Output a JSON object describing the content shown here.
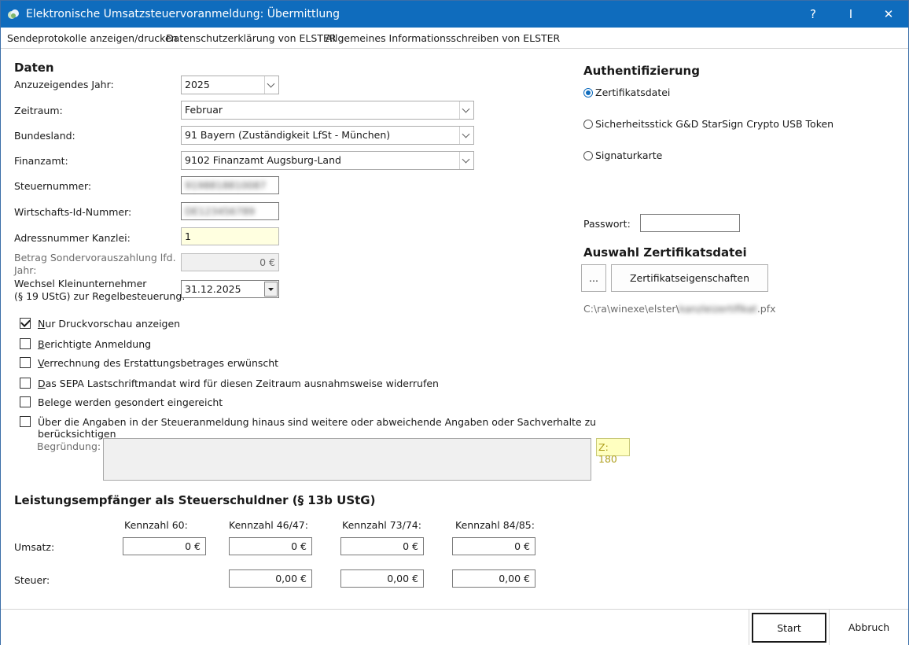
{
  "window": {
    "title": "Elektronische Umsatzsteuervoranmeldung: Übermittlung",
    "help": "?",
    "restore": "I",
    "close": "✕"
  },
  "menu": [
    "Sendeprotokolle anzeigen/drucken",
    "Datenschutzerklärung von ELSTER",
    "Allgemeines Informationsschreiben von ELSTER"
  ],
  "daten": {
    "heading": "Daten",
    "jahr_label": "Anzuzeigendes Jahr:",
    "jahr_value": "2025",
    "zeitraum_label": "Zeitraum:",
    "zeitraum_value": "Februar",
    "bundesland_label": "Bundesland:",
    "bundesland_value": "91 Bayern (Zuständigkeit LfSt - München)",
    "finanzamt_label": "Finanzamt:",
    "finanzamt_value": "9102 Finanzamt Augsburg-Land",
    "steuernummer_label": "Steuernummer:",
    "steuernummer_value": "9198818810087",
    "wid_label": "Wirtschafts-Id-Nummer:",
    "wid_value": "DE123456789",
    "adress_label": "Adressnummer Kanzlei:",
    "adress_value": "1",
    "betrag_label_1": "Betrag Sondervorauszahlung lfd.",
    "betrag_label_2": "Jahr:",
    "betrag_value": "0 €",
    "wechsel_label_1": "Wechsel Kleinunternehmer",
    "wechsel_label_2": "(§ 19 UStG) zur Regelbesteuerung:",
    "wechsel_value": "31.12.2025"
  },
  "checkboxes": [
    {
      "first": "N",
      "rest": "ur Druckvorschau anzeigen",
      "checked": true
    },
    {
      "first": "B",
      "rest": "erichtigte Anmeldung",
      "checked": false
    },
    {
      "first": "V",
      "rest": "errechnung des Erstattungsbetrages erwünscht",
      "checked": false
    },
    {
      "first": "D",
      "rest": "as SEPA Lastschriftmandat wird für diesen Zeitraum ausnahmsweise widerrufen",
      "checked": false
    },
    {
      "first": "",
      "rest": "Belege werden gesondert eingereicht",
      "checked": false
    },
    {
      "first": "",
      "rest": "Über die Angaben in der Steueranmeldung hinaus sind weitere oder abweichende Angaben oder Sachverhalte zu berücksichtigen",
      "checked": false
    }
  ],
  "begruendung": {
    "label": "Begründung:",
    "counter": "Z: 180"
  },
  "leistung": {
    "heading": "Leistungsempfänger als Steuerschuldner (§ 13b UStG)",
    "kennzahlen": [
      "Kennzahl 60:",
      "Kennzahl 46/47:",
      "Kennzahl 73/74:",
      "Kennzahl 84/85:"
    ],
    "umsatz_label": "Umsatz:",
    "umsatz": [
      "0 €",
      "0 €",
      "0 €",
      "0 €"
    ],
    "steuer_label": "Steuer:",
    "steuer": [
      "0,00 €",
      "0,00 €",
      "0,00 €"
    ]
  },
  "auth": {
    "heading": "Authentifizierung",
    "options": [
      {
        "label": "Zertifikatsdatei",
        "selected": true
      },
      {
        "label": "Sicherheitsstick G&D StarSign Crypto USB Token",
        "selected": false
      },
      {
        "label": "Signaturkarte",
        "selected": false
      }
    ],
    "passwort_label": "Passwort:",
    "passwort_value": ""
  },
  "zert": {
    "heading": "Auswahl Zertifikatsdatei",
    "browse": "...",
    "props": "Zertifikatseigenschaften",
    "path_prefix": "C:\\ra\\winexe\\elster\\",
    "path_name": "kanzleizertifikat",
    "path_ext": ".pfx"
  },
  "footer": {
    "start": "Start",
    "abbruch": "Abbruch"
  }
}
